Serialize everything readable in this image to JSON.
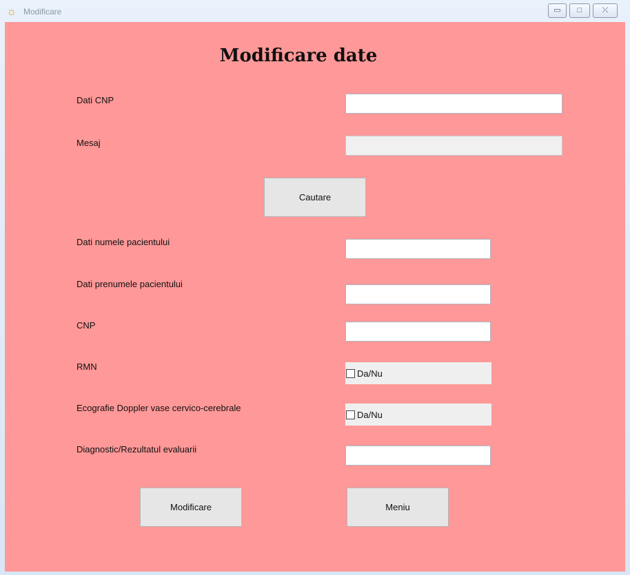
{
  "window": {
    "title": "Modificare",
    "buttons": {
      "minimize": "▭",
      "maximize": "□",
      "close": "⤫"
    }
  },
  "form": {
    "heading": "Modificare date",
    "labels": {
      "cnp_search": "Dati CNP",
      "message": "Mesaj",
      "last_name": "Dati numele pacientului",
      "first_name": "Dati prenumele pacientului",
      "cnp": "CNP",
      "rmn": "RMN",
      "doppler": "Ecografie Doppler vase cervico-cerebrale",
      "diagnosis": "Diagnostic/Rezultatul evaluarii"
    },
    "inputs": {
      "cnp_search": "",
      "message": "",
      "last_name": "",
      "first_name": "",
      "cnp": "",
      "diagnosis": ""
    },
    "checkboxes": {
      "rmn": "Da/Nu",
      "doppler": "Da/Nu"
    },
    "buttons": {
      "search": "Cautare",
      "modify": "Modificare",
      "menu": "Meniu"
    }
  }
}
